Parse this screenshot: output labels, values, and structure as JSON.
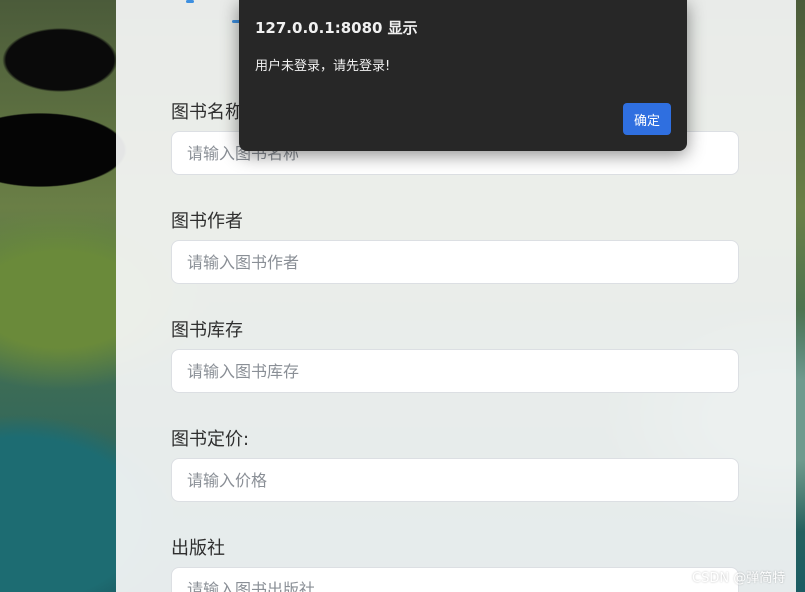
{
  "dialog": {
    "title": "127.0.0.1:8080 显示",
    "message": "用户未登录，请先登录!",
    "ok_label": "确定"
  },
  "form": {
    "fields": [
      {
        "label": "图书名称",
        "placeholder": "请输入图书名称"
      },
      {
        "label": "图书作者",
        "placeholder": "请输入图书作者"
      },
      {
        "label": "图书库存",
        "placeholder": "请输入图书库存"
      },
      {
        "label": "图书定价:",
        "placeholder": "请输入价格"
      },
      {
        "label": "出版社",
        "placeholder": "请输入图书出版社"
      }
    ]
  },
  "watermark": "CSDN @弹简特",
  "colors": {
    "dialog_bg": "#272727",
    "ok_button": "#2f6fe0",
    "accent": "#3d8fe0"
  }
}
